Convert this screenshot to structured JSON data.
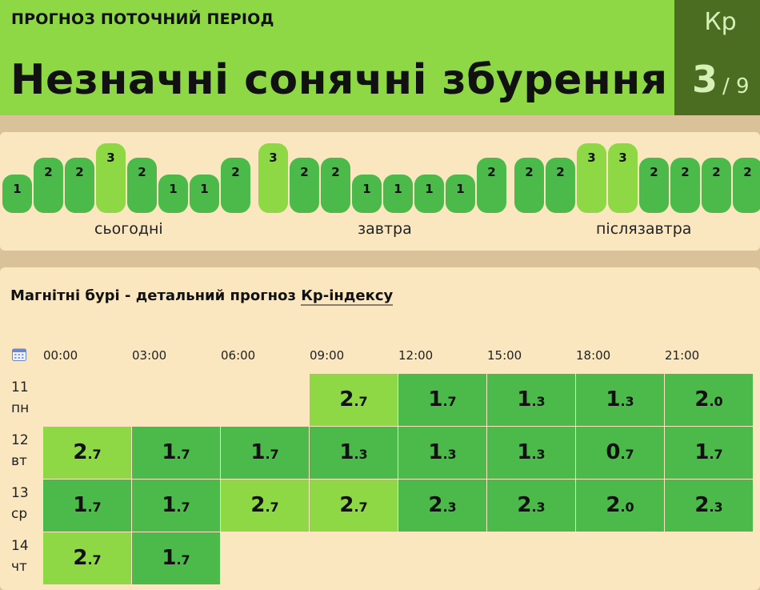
{
  "header": {
    "subtitle": "ПРОГНОЗ ПОТОЧНИЙ ПЕРІОД",
    "title": "Незначні сонячні збурення",
    "kp_label": "Кр",
    "kp_value": "3",
    "kp_max": "/ 9",
    "accent_color": "#8fd845",
    "kp_box_color": "#4a6d22"
  },
  "bars": {
    "values": [
      1,
      2,
      2,
      3,
      2,
      1,
      1,
      2,
      3,
      2,
      2,
      1,
      1,
      1,
      1,
      2,
      2,
      2,
      3,
      3,
      2,
      2,
      2,
      2
    ],
    "colors": {
      "low": "#4cba4a",
      "elevated": "#8fd845"
    },
    "day_labels": [
      "сьогодні",
      "завтра",
      "післязавтра"
    ]
  },
  "detail": {
    "title_prefix": "Магнітні бурі - детальний прогноз ",
    "title_link": "Кр-індексу",
    "calendar_icon": "calendar-icon",
    "times": [
      "00:00",
      "03:00",
      "06:00",
      "09:00",
      "12:00",
      "15:00",
      "18:00",
      "21:00"
    ],
    "rows": [
      {
        "date": "11",
        "weekday": "пн",
        "values": [
          null,
          null,
          null,
          "2.7",
          "1.7",
          "1.3",
          "1.3",
          "2.0"
        ]
      },
      {
        "date": "12",
        "weekday": "вт",
        "values": [
          "2.7",
          "1.7",
          "1.7",
          "1.3",
          "1.3",
          "1.3",
          "0.7",
          "1.7"
        ]
      },
      {
        "date": "13",
        "weekday": "ср",
        "values": [
          "1.7",
          "1.7",
          "2.7",
          "2.7",
          "2.3",
          "2.3",
          "2.0",
          "2.3"
        ]
      },
      {
        "date": "14",
        "weekday": "чт",
        "values": [
          "2.7",
          "1.7",
          null,
          null,
          null,
          null,
          null,
          null
        ]
      }
    ]
  }
}
